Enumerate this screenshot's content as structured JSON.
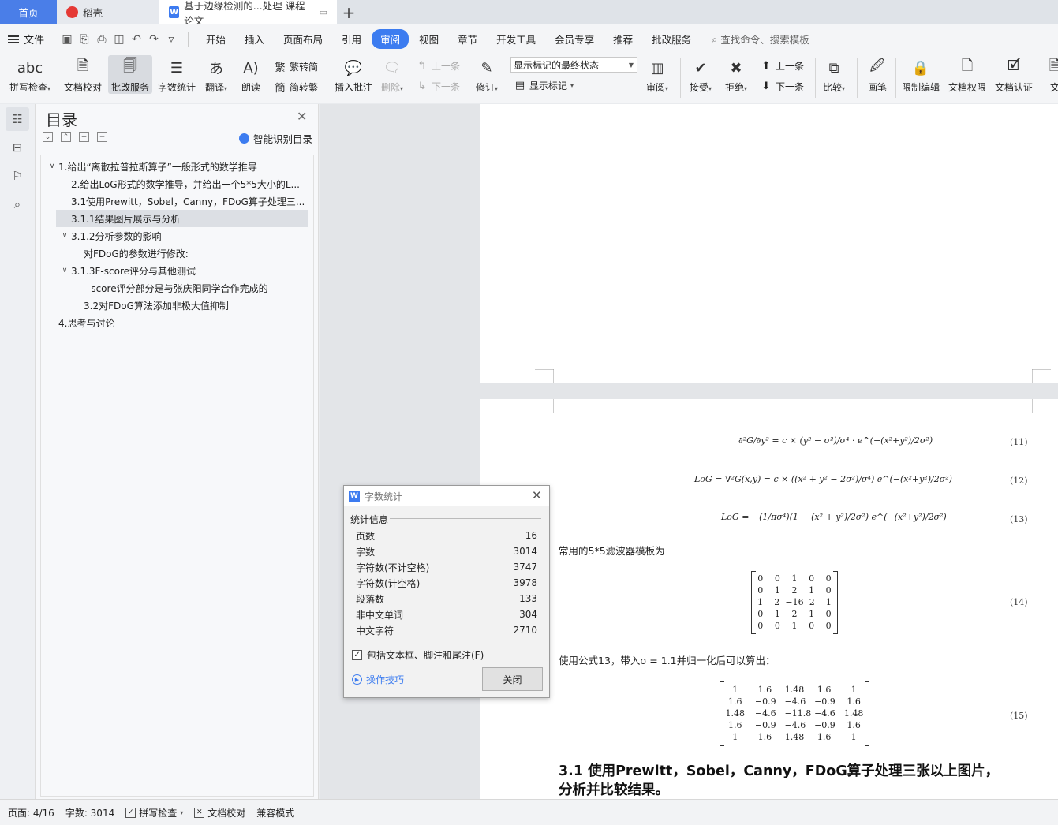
{
  "tabs": {
    "home": "首页",
    "daoke": "稻壳",
    "document": "基于边缘检测的...处理 课程论文",
    "add": "+"
  },
  "menu": {
    "file": "文件",
    "items": [
      "开始",
      "插入",
      "页面布局",
      "引用",
      "审阅",
      "视图",
      "章节",
      "开发工具",
      "会员专享",
      "推荐",
      "批改服务"
    ],
    "active": "审阅",
    "search": "查找命令、搜索模板"
  },
  "ribbon": {
    "spell_check": "拼写检查",
    "doc_proofread": "文档校对",
    "correction_service": "批改服务",
    "word_count": "字数统计",
    "translate": "翻译",
    "read_aloud": "朗读",
    "trad_to_simp": "繁转简",
    "simp_to_trad": "简转繁",
    "insert_comment": "插入批注",
    "delete": "删除",
    "prev": "上一条",
    "next": "下一条",
    "track_changes": "修订",
    "markup_select": "显示标记的最终状态",
    "show_markup": "显示标记",
    "review": "审阅",
    "accept": "接受",
    "reject": "拒绝",
    "prev_change": "上一条",
    "next_change": "下一条",
    "compare": "比较",
    "pen": "画笔",
    "restrict_edit": "限制编辑",
    "doc_permission": "文档权限",
    "doc_auth": "文档认证",
    "doc_partial": "文"
  },
  "toc": {
    "title": "目录",
    "smart_label": "智能识别目录",
    "items": [
      {
        "text": "1.给出“离散拉普拉斯算子”一般形式的数学推导",
        "expanded": true
      },
      {
        "text": "2.给出LoG形式的数学推导，并给出一个5*5大小的L..."
      },
      {
        "text": "3.1使用Prewitt，Sobel，Canny，FDoG算子处理三..."
      },
      {
        "text": "3.1.1结果图片展示与分析",
        "selected": true
      },
      {
        "text": "3.1.2分析参数的影响",
        "expanded": true
      },
      {
        "text": "对FDoG的参数进行修改:"
      },
      {
        "text": "3.1.3F-score评分与其他测试",
        "expanded": true
      },
      {
        "text": "-score评分部分是与张庆阳同学合作完成的"
      },
      {
        "text": "3.2对FDoG算法添加非极大值抑制"
      },
      {
        "text": "4.思考与讨论"
      }
    ]
  },
  "document": {
    "eq11": "∂²G/∂y² = c × (y² − σ²)/σ⁴ · e^(−(x²+y²)/2σ²)",
    "eq12": "LoG = ∇²G(x,y) = c × ((x² + y² − 2σ²)/σ⁴) e^(−(x²+y²)/2σ²)",
    "eq13": "LoG = −(1/πσ⁴)(1 − (x² + y²)/2σ²) e^(−(x²+y²)/2σ²)",
    "eqnums": [
      "(11)",
      "(12)",
      "(13)",
      "(14)",
      "(15)"
    ],
    "text_filter": "常用的5*5滤波器模板为",
    "matrix14": [
      [
        "0",
        "0",
        "1",
        "0",
        "0"
      ],
      [
        "0",
        "1",
        "2",
        "1",
        "0"
      ],
      [
        "1",
        "2",
        "−16",
        "2",
        "1"
      ],
      [
        "0",
        "1",
        "2",
        "1",
        "0"
      ],
      [
        "0",
        "0",
        "1",
        "0",
        "0"
      ]
    ],
    "text_apply": "使用公式13，带入σ = 1.1并归一化后可以算出：",
    "matrix15": [
      [
        "1",
        "1.6",
        "1.48",
        "1.6",
        "1"
      ],
      [
        "1.6",
        "−0.9",
        "−4.6",
        "−0.9",
        "1.6"
      ],
      [
        "1.48",
        "−4.6",
        "−11.8",
        "−4.6",
        "1.48"
      ],
      [
        "1.6",
        "−0.9",
        "−4.6",
        "−0.9",
        "1.6"
      ],
      [
        "1",
        "1.6",
        "1.48",
        "1.6",
        "1"
      ]
    ],
    "heading_line1": "3.1 使用Prewitt，Sobel，Canny，FDoG算子处理三张以上图片，",
    "heading_line2": "分析并比较结果。"
  },
  "dialog": {
    "title": "字数统计",
    "group": "统计信息",
    "stats": [
      {
        "label": "页数",
        "value": "16"
      },
      {
        "label": "字数",
        "value": "3014"
      },
      {
        "label": "字符数(不计空格)",
        "value": "3747"
      },
      {
        "label": "字符数(计空格)",
        "value": "3978"
      },
      {
        "label": "段落数",
        "value": "133"
      },
      {
        "label": "非中文单词",
        "value": "304"
      },
      {
        "label": "中文字符",
        "value": "2710"
      }
    ],
    "checkbox": "包括文本框、脚注和尾注(F)",
    "tips": "操作技巧",
    "close": "关闭"
  },
  "status": {
    "page": "页面: 4/16",
    "words": "字数: 3014",
    "spell": "拼写检查",
    "proofread": "文档校对",
    "compat": "兼容模式"
  },
  "colors": {
    "accent": "#3c7cf0",
    "home_tab": "#4a7ee8"
  }
}
